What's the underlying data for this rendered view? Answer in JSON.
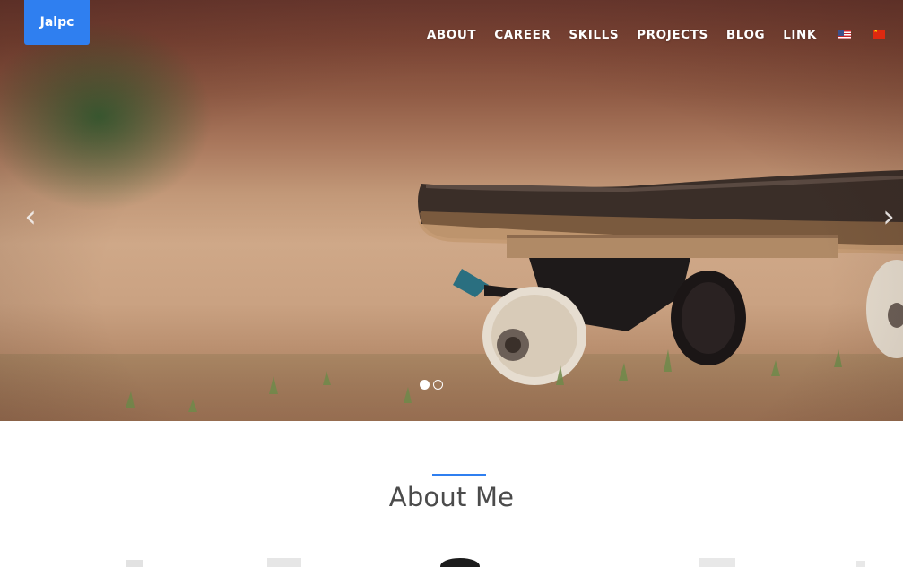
{
  "brand": {
    "label": "Jalpc",
    "color": "#2f7ff0"
  },
  "nav": {
    "items": [
      {
        "label": "ABOUT"
      },
      {
        "label": "CAREER"
      },
      {
        "label": "SKILLS"
      },
      {
        "label": "PROJECTS"
      },
      {
        "label": "BLOG"
      },
      {
        "label": "LINK"
      }
    ],
    "flags": [
      {
        "icon": "us-flag-icon"
      },
      {
        "icon": "cn-flag-icon"
      }
    ]
  },
  "carousel": {
    "prev_icon": "chevron-left-icon",
    "next_icon": "chevron-right-icon",
    "prev_glyph": "‹",
    "next_glyph": "›",
    "slide_count": 2,
    "active_slide": 1
  },
  "about": {
    "title": "About Me",
    "accent_color": "#2f7ff0"
  }
}
